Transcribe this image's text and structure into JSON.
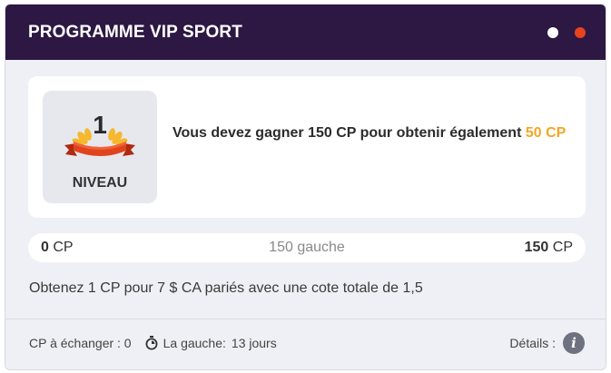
{
  "header": {
    "title": "PROGRAMME VIP SPORT"
  },
  "level": {
    "number": "1",
    "label": "NIVEAU",
    "message": "Vous devez gagner 150 CP pour obtenir également",
    "reward": "50 CP"
  },
  "progress": {
    "current_value": "0",
    "current_unit": "CP",
    "remaining": "150 gauche",
    "target_value": "150",
    "target_unit": "CP",
    "fraction": 0
  },
  "info": "Obtenez 1 CP pour 7 $ CA pariés avec une cote totale de 1,5",
  "footer": {
    "exchange": "CP à échanger : 0",
    "time_label": "La gauche:",
    "time_value": "13 jours",
    "details_label": "Détails :",
    "info_icon_glyph": "i"
  },
  "colors": {
    "header_bg": "#2d1843",
    "accent": "#f5a623",
    "dot_active": "#e8431f",
    "dot_inactive": "#ffffff"
  },
  "icons": [
    "laurel-ribbon-icon",
    "stopwatch-icon",
    "info-icon"
  ]
}
